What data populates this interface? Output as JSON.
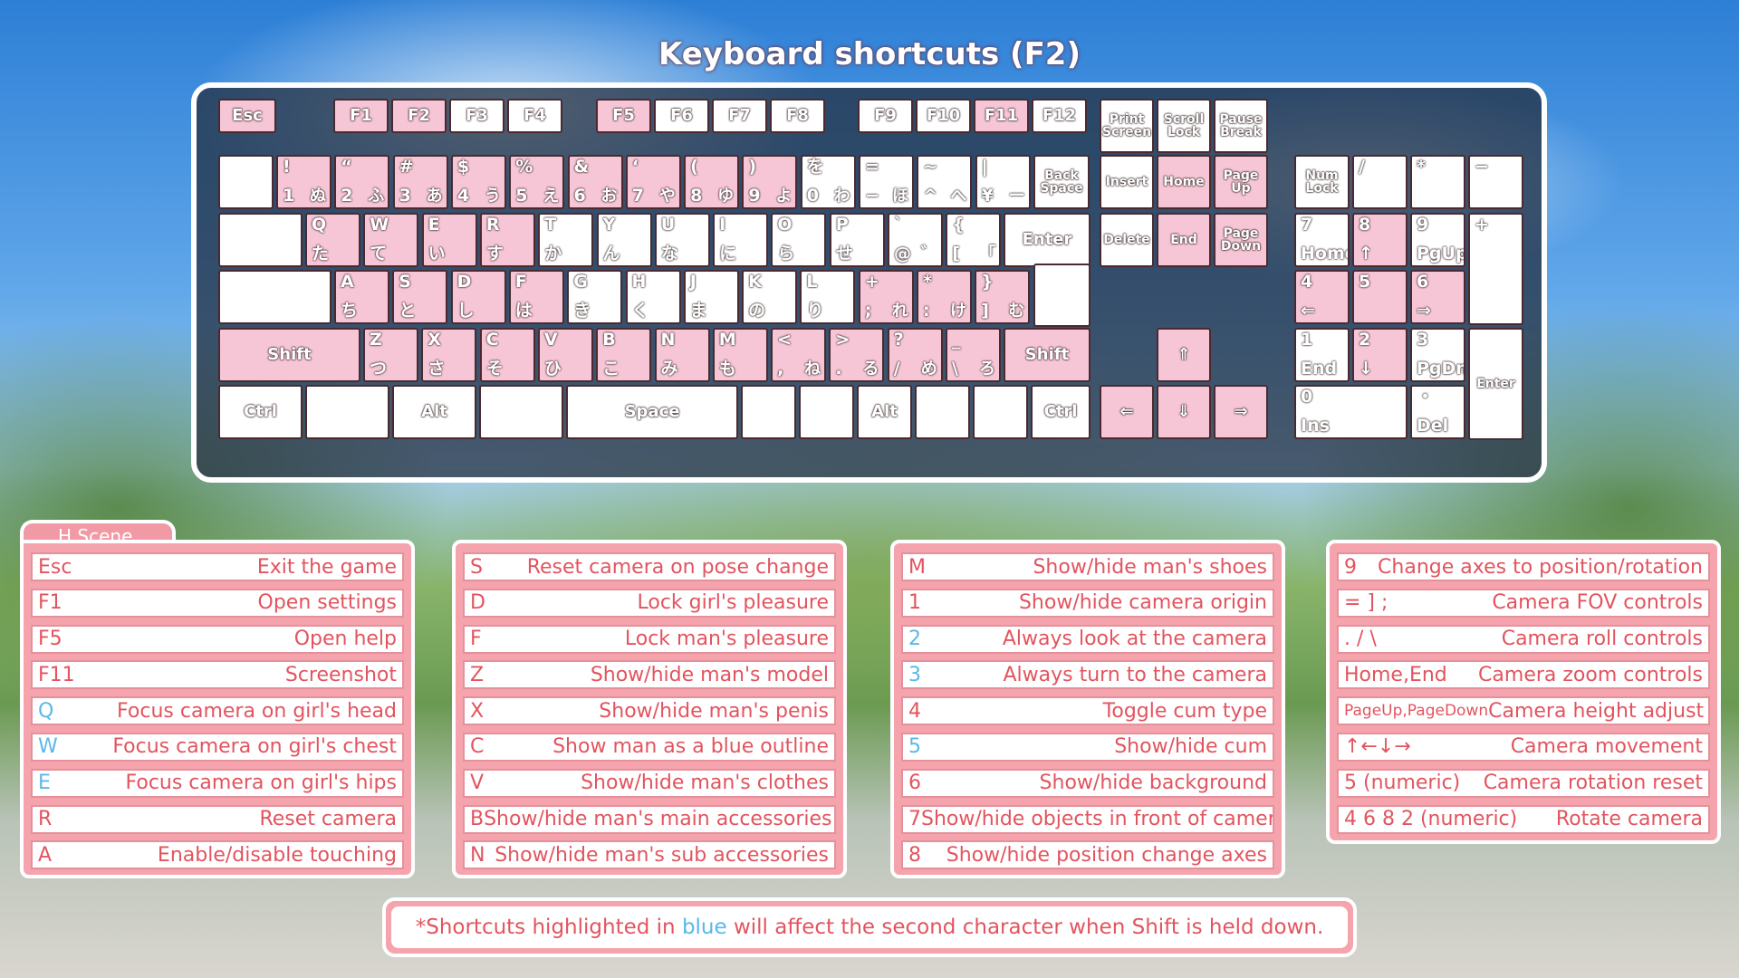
{
  "title": "Keyboard shortcuts (F2)",
  "keys": {
    "esc": "Esc",
    "f1": "F1",
    "f2": "F2",
    "f3": "F3",
    "f4": "F4",
    "f5": "F5",
    "f6": "F6",
    "f7": "F7",
    "f8": "F8",
    "f9": "F9",
    "f10": "F10",
    "f11": "F11",
    "f12": "F12",
    "print": "Print\nScreen",
    "scroll": "Scroll\nLock",
    "pause": "Pause\nBreak",
    "backspace": "Back\nSpace",
    "insert": "Insert",
    "home": "Home",
    "pageup": "Page\nUp",
    "numlock": "Num\nLock",
    "nslash": "/",
    "nstar": "*",
    "nminus": "−",
    "enter": "Enter",
    "delete": "Delete",
    "end": "End",
    "pagedown": "Page\nDown",
    "nplus": "+",
    "n7": "7",
    "n7b": "Home",
    "n8": "8",
    "n8b": "↑",
    "n9": "9",
    "n9b": "PgUp",
    "n4": "4",
    "n4b": "⇐",
    "n5": "5",
    "n6": "6",
    "n6b": "⇒",
    "shift": "Shift",
    "n1": "1",
    "n1b": "End",
    "n2": "2",
    "n2b": "↓",
    "n3": "3",
    "n3b": "PgDn",
    "nenter": "Enter",
    "ctrl": "Ctrl",
    "alt": "Alt",
    "space": "Space",
    "n0": "0",
    "n0b": "Ins",
    "ndot": "・",
    "ndotb": "Del",
    "up": "⇑",
    "left": "⇐",
    "down": "⇓",
    "right": "⇒",
    "r1": [
      [
        "!",
        "1",
        "ぬ"
      ],
      [
        "“",
        "2",
        "ふ"
      ],
      [
        "#",
        "3",
        "あ"
      ],
      [
        "$",
        "4",
        "う"
      ],
      [
        "%",
        "5",
        "え"
      ],
      [
        "&",
        "6",
        "お"
      ],
      [
        "‘",
        "7",
        "や"
      ],
      [
        "(",
        "8",
        "ゆ"
      ],
      [
        ")",
        "9",
        "よ"
      ],
      [
        "を",
        "0",
        "わ"
      ],
      [
        "=",
        "−",
        "ほ"
      ],
      [
        "~",
        "^",
        "へ"
      ],
      [
        "|",
        "¥",
        "ー"
      ]
    ],
    "r2": [
      [
        "Q",
        "た"
      ],
      [
        "W",
        "て"
      ],
      [
        "E",
        "い"
      ],
      [
        "R",
        "す"
      ],
      [
        "T",
        "か"
      ],
      [
        "Y",
        "ん"
      ],
      [
        "U",
        "な"
      ],
      [
        "I",
        "に"
      ],
      [
        "O",
        "ら"
      ],
      [
        "P",
        "せ"
      ],
      [
        "`",
        "@",
        "゛"
      ],
      [
        "{",
        "[",
        "「"
      ]
    ],
    "r3": [
      [
        "A",
        "ち"
      ],
      [
        "S",
        "と"
      ],
      [
        "D",
        "し"
      ],
      [
        "F",
        "は"
      ],
      [
        "G",
        "き"
      ],
      [
        "H",
        "く"
      ],
      [
        "J",
        "ま"
      ],
      [
        "K",
        "の"
      ],
      [
        "L",
        "り"
      ],
      [
        "+",
        ";",
        "れ"
      ],
      [
        "*",
        ":",
        "け"
      ],
      [
        "}",
        "]",
        "む"
      ]
    ],
    "r4": [
      [
        "Z",
        "つ"
      ],
      [
        "X",
        "さ"
      ],
      [
        "C",
        "そ"
      ],
      [
        "V",
        "ひ"
      ],
      [
        "B",
        "こ"
      ],
      [
        "N",
        "み"
      ],
      [
        "M",
        "も"
      ],
      [
        "<",
        ",",
        "ね"
      ],
      [
        ">",
        ".",
        "る"
      ],
      [
        "?",
        "/",
        "め"
      ],
      [
        "_",
        "\\",
        "ろ"
      ]
    ]
  },
  "tab": "H Scene",
  "panels": [
    [
      {
        "k": "Esc",
        "d": "Exit the game"
      },
      {
        "k": "F1",
        "d": "Open settings"
      },
      {
        "k": "F5",
        "d": "Open help"
      },
      {
        "k": "F11",
        "d": "Screenshot"
      },
      {
        "k": "Q",
        "d": "Focus camera on girl's head",
        "blue": true
      },
      {
        "k": "W",
        "d": "Focus camera on girl's chest",
        "blue": true
      },
      {
        "k": "E",
        "d": "Focus camera on girl's hips",
        "blue": true
      },
      {
        "k": "R",
        "d": "Reset camera"
      },
      {
        "k": "A",
        "d": "Enable/disable touching"
      }
    ],
    [
      {
        "k": "S",
        "d": "Reset camera on pose change"
      },
      {
        "k": "D",
        "d": "Lock girl's pleasure"
      },
      {
        "k": "F",
        "d": "Lock man's pleasure"
      },
      {
        "k": "Z",
        "d": "Show/hide man's model"
      },
      {
        "k": "X",
        "d": "Show/hide man's penis"
      },
      {
        "k": "C",
        "d": "Show man as a blue outline"
      },
      {
        "k": "V",
        "d": "Show/hide man's clothes"
      },
      {
        "k": "B",
        "d": "Show/hide man's main accessories"
      },
      {
        "k": "N",
        "d": "Show/hide man's sub accessories"
      }
    ],
    [
      {
        "k": "M",
        "d": "Show/hide man's shoes"
      },
      {
        "k": "1",
        "d": "Show/hide camera origin"
      },
      {
        "k": "2",
        "d": "Always look at the camera",
        "blue": true
      },
      {
        "k": "3",
        "d": "Always turn to the camera",
        "blue": true
      },
      {
        "k": "4",
        "d": "Toggle cum type"
      },
      {
        "k": "5",
        "d": "Show/hide cum",
        "blue": true
      },
      {
        "k": "6",
        "d": "Show/hide background"
      },
      {
        "k": "7",
        "d": "Show/hide objects in front of camera"
      },
      {
        "k": "8",
        "d": "Show/hide position change axes"
      }
    ],
    [
      {
        "k": "9",
        "d": "Change axes to position/rotation"
      },
      {
        "k": "= ] ;",
        "d": "Camera FOV controls"
      },
      {
        "k": ". / \\",
        "d": "Camera roll controls"
      },
      {
        "k": "Home,End",
        "d": "Camera zoom controls"
      },
      {
        "k": "PageUp,PageDown",
        "d": "Camera height adjust",
        "small": true
      },
      {
        "k": "↑←↓→",
        "d": "Camera movement"
      },
      {
        "k": "5 (numeric)",
        "d": "Camera rotation reset"
      },
      {
        "k": "4 6 8 2 (numeric)",
        "d": "Rotate camera"
      }
    ]
  ],
  "note": {
    "before": "*Shortcuts highlighted in ",
    "blue": "blue",
    "after": " will affect the second character when Shift is held down."
  },
  "colors": {
    "pink_key": "#f7c6d6",
    "panel": "#f5a3ad",
    "text": "#e2545f",
    "blue": "#5ab8e6"
  }
}
